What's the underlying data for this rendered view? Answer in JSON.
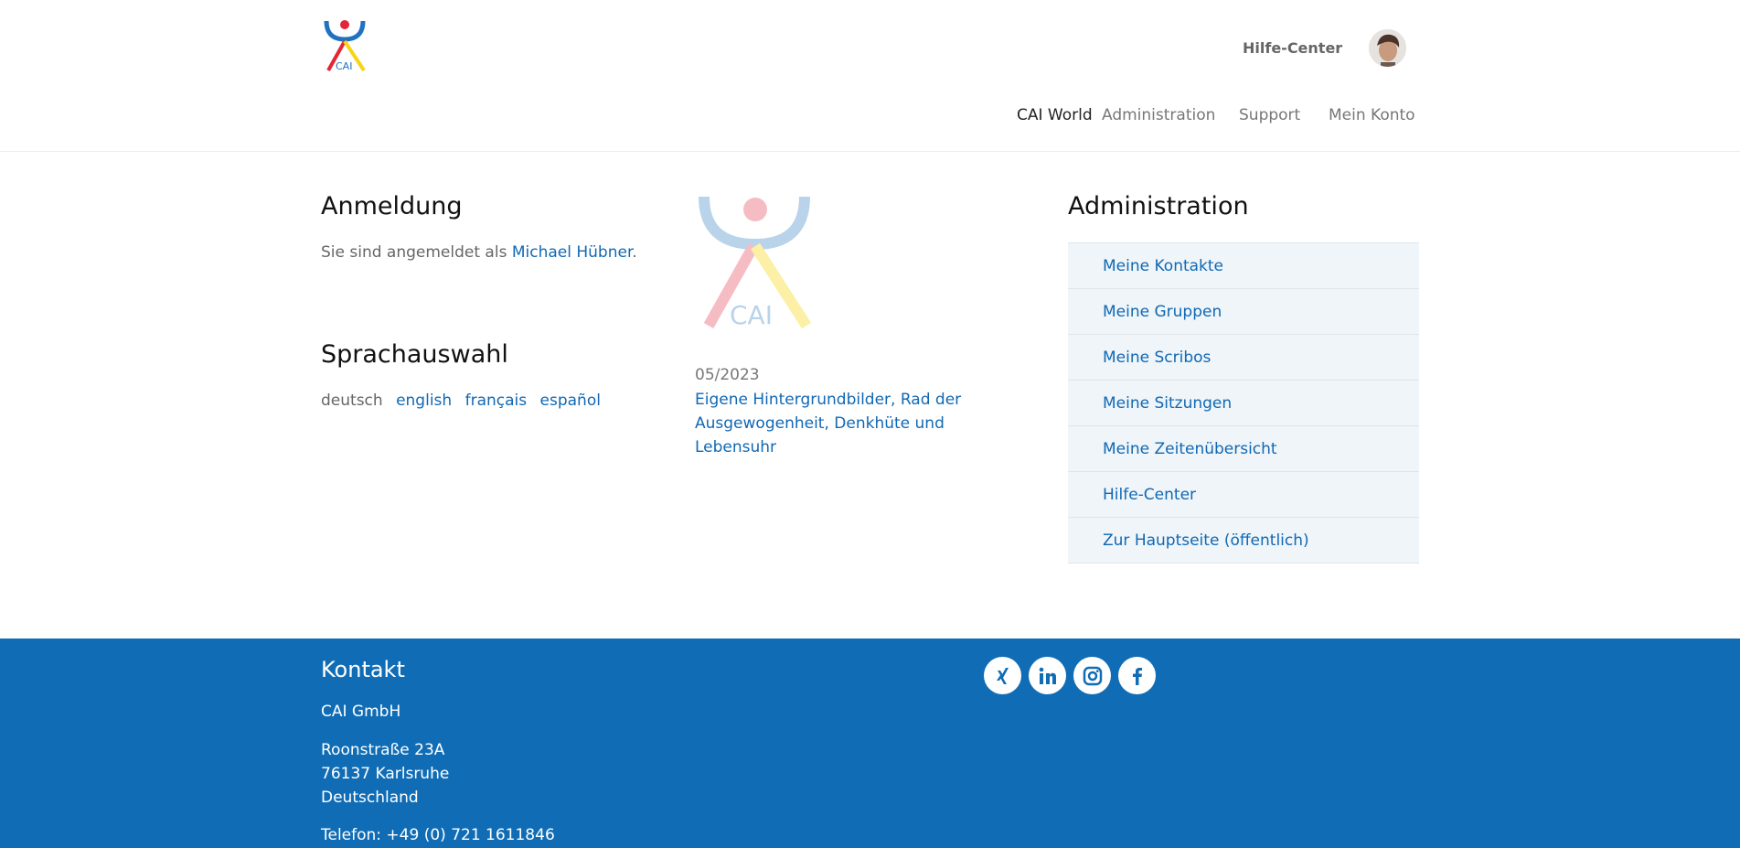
{
  "header": {
    "logo_text": "CAI",
    "help_link": "Hilfe-Center",
    "nav": [
      "CAI World",
      "Administration",
      "Support",
      "Mein Konto"
    ]
  },
  "login": {
    "title": "Anmeldung",
    "text_prefix": "Sie sind angemeldet als ",
    "user": "Michael Hübner",
    "text_suffix": "."
  },
  "language": {
    "title": "Sprachauswahl",
    "current": "deutsch",
    "options": [
      "english",
      "français",
      "español"
    ]
  },
  "news": {
    "logo_text": "CAI",
    "date": "05/2023",
    "link": "Eigene Hintergrundbilder, Rad der Ausgewogenheit, Denkhüte und Lebensuhr"
  },
  "admin": {
    "title": "Administration",
    "items": [
      "Meine Kontakte",
      "Meine Gruppen",
      "Meine Scribos",
      "Meine Sitzungen",
      "Meine Zeitenübersicht",
      "Hilfe-Center",
      "Zur Hauptseite (öffentlich)"
    ]
  },
  "footer": {
    "title": "Kontakt",
    "company": "CAI GmbH",
    "street": "Roonstraße 23A",
    "city": "76137 Karlsruhe",
    "country": "Deutschland",
    "phone": "Telefon: +49 (0) 721 1611846",
    "social": [
      "xing-icon",
      "linkedin-icon",
      "instagram-icon",
      "facebook-icon"
    ]
  },
  "colors": {
    "link": "#1168b4",
    "footer_bg": "#106db5",
    "admin_item_bg": "#eff5f9",
    "logo_blue": "#1f72c1",
    "logo_red": "#e32636",
    "logo_yellow": "#f6d417"
  }
}
